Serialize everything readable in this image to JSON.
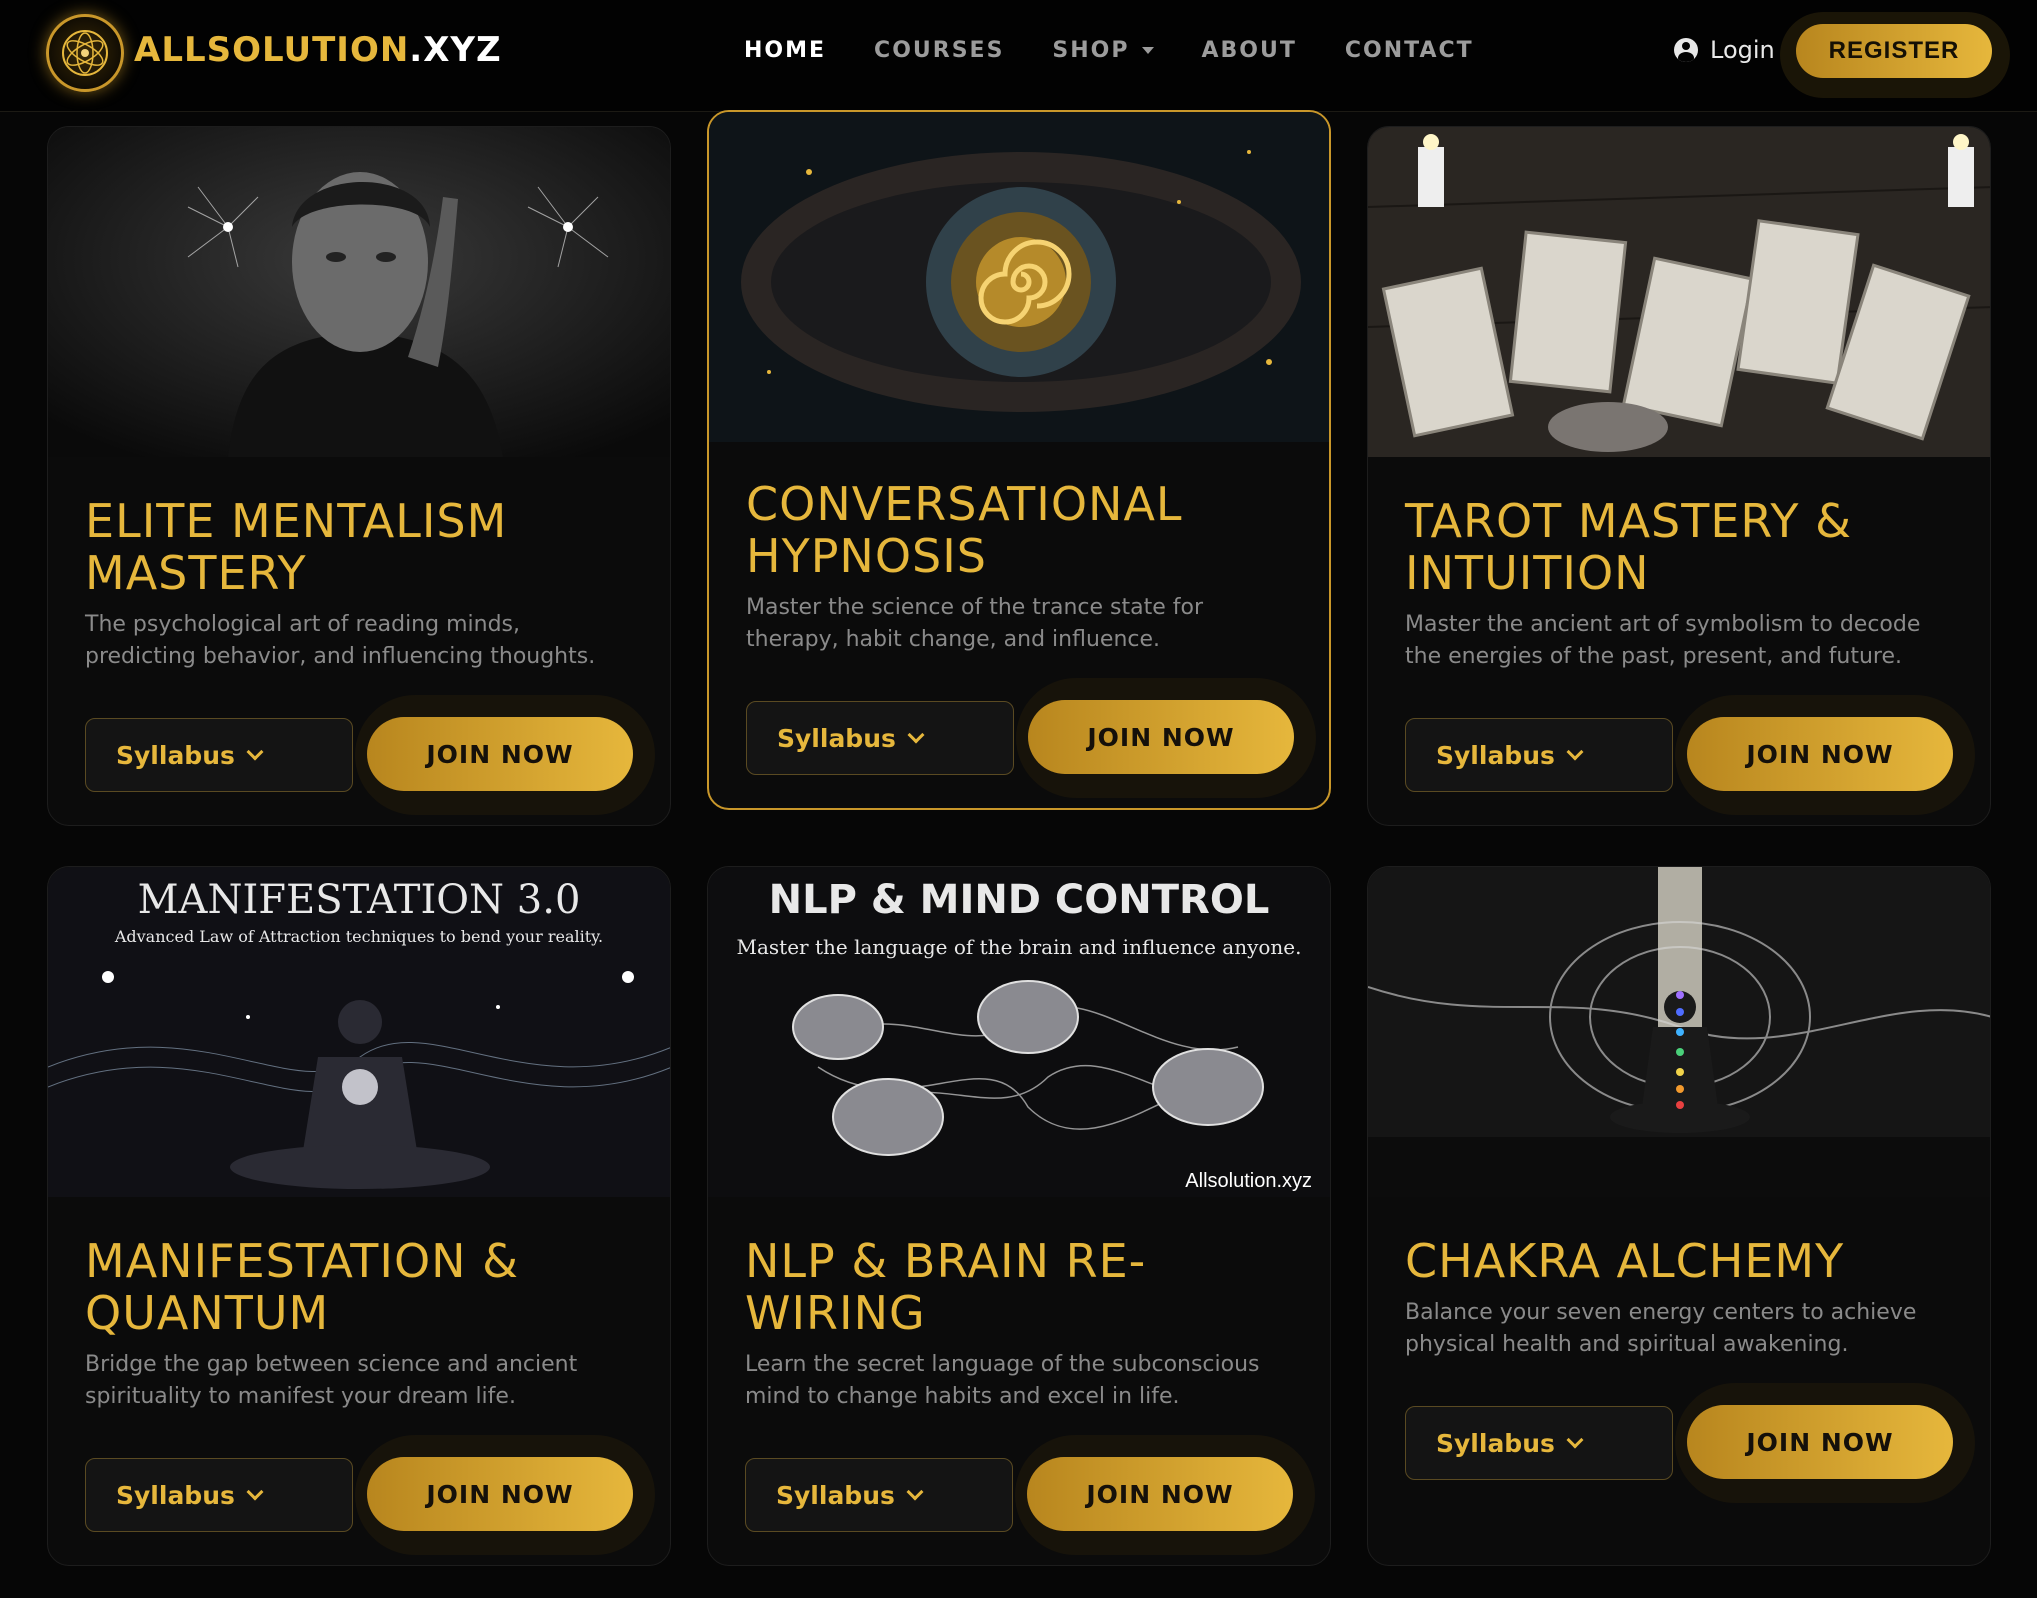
{
  "nav": {
    "brand_main": "ALLSOLUTION",
    "brand_tld": ".XYZ",
    "items": [
      {
        "label": "HOME",
        "active": true
      },
      {
        "label": "COURSES",
        "active": false
      },
      {
        "label": "SHOP",
        "active": false,
        "dropdown": true
      },
      {
        "label": "ABOUT",
        "active": false
      },
      {
        "label": "CONTACT",
        "active": false
      }
    ],
    "login_label": "Login",
    "register_label": "REGISTER"
  },
  "courses": [
    {
      "title": "ELITE MENTALISM MASTERY",
      "description": "The psychological art of reading minds, predicting behavior, and influencing thoughts.",
      "syllabus_label": "Syllabus",
      "join_label": "JOIN NOW"
    },
    {
      "title": "CONVERSATIONAL HYPNOSIS",
      "description": "Master the science of the trance state for therapy, habit change, and influence.",
      "syllabus_label": "Syllabus",
      "join_label": "JOIN NOW"
    },
    {
      "title": "TAROT MASTERY & INTUITION",
      "description": "Master the ancient art of symbolism to decode the energies of the past, present, and future.",
      "syllabus_label": "Syllabus",
      "join_label": "JOIN NOW"
    },
    {
      "title": "MANIFESTATION & QUANTUM",
      "description": "Bridge the gap between science and ancient spirituality to manifest your dream life.",
      "syllabus_label": "Syllabus",
      "join_label": "JOIN NOW",
      "image_title": "MANIFESTATION 3.0",
      "image_subtitle": "Advanced Law of Attraction techniques to bend your reality."
    },
    {
      "title": "NLP & BRAIN RE-WIRING",
      "description": "Learn the secret language of the subconscious mind to change habits and excel in life.",
      "syllabus_label": "Syllabus",
      "join_label": "JOIN NOW",
      "image_title": "NLP & MIND CONTROL",
      "image_subtitle": "Master the language of the brain and influence anyone.",
      "image_watermark": "Allsolution.xyz"
    },
    {
      "title": "CHAKRA ALCHEMY",
      "description": "Balance your seven energy centers to achieve physical health and spiritual awakening.",
      "syllabus_label": "Syllabus",
      "join_label": "JOIN NOW"
    }
  ],
  "colors": {
    "accent": "#e6b73c",
    "background": "#060606",
    "card": "#0b0b0b"
  }
}
